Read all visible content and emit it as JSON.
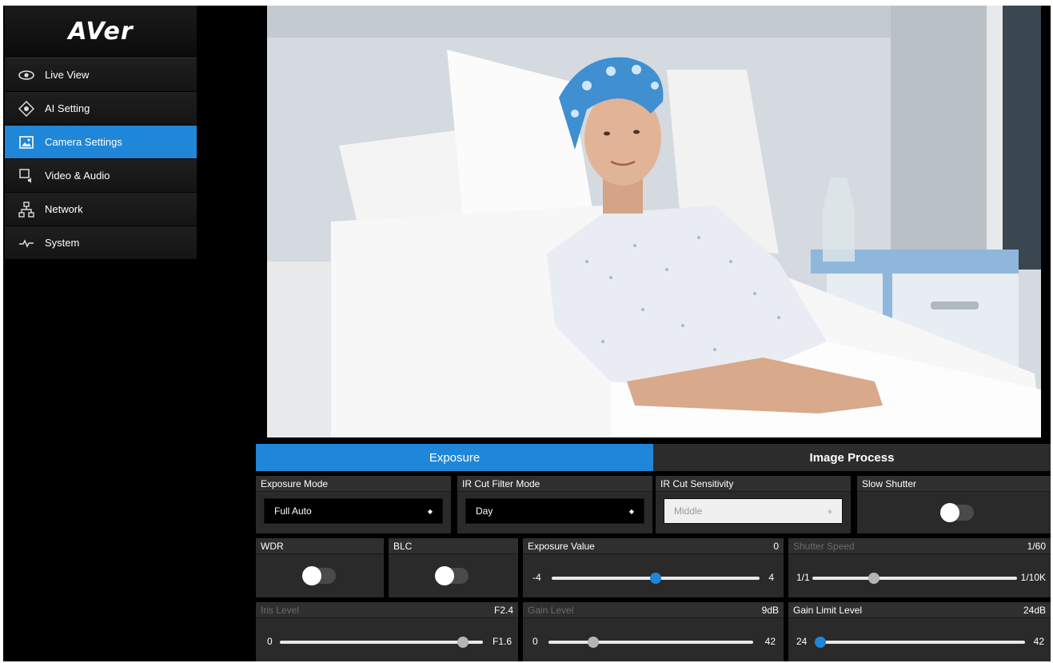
{
  "brand": {
    "logo_text": "AVer"
  },
  "sidebar": {
    "items": [
      {
        "label": "Live View",
        "icon": "eye-icon"
      },
      {
        "label": "AI Setting",
        "icon": "ai-target-icon"
      },
      {
        "label": "Camera Settings",
        "icon": "image-icon",
        "active": true
      },
      {
        "label": "Video & Audio",
        "icon": "video-audio-icon"
      },
      {
        "label": "Network",
        "icon": "network-icon"
      },
      {
        "label": "System",
        "icon": "pulse-icon"
      }
    ]
  },
  "tabs": {
    "exposure": "Exposure",
    "image_process": "Image Process"
  },
  "exposure": {
    "exposure_mode": {
      "label": "Exposure Mode",
      "value": "Full Auto"
    },
    "ir_cut_filter_mode": {
      "label": "IR Cut Filter Mode",
      "value": "Day"
    },
    "ir_cut_sensitivity": {
      "label": "IR Cut Sensitivity",
      "value": "Middle"
    },
    "slow_shutter": {
      "label": "Slow Shutter",
      "on": false
    },
    "wdr": {
      "label": "WDR",
      "on": false
    },
    "blc": {
      "label": "BLC",
      "on": false
    },
    "exposure_value": {
      "label": "Exposure Value",
      "value": "0",
      "min": "-4",
      "max": "4",
      "position": 0.5
    },
    "shutter_speed": {
      "label": "Shutter Speed",
      "value": "1/60",
      "min": "1/1",
      "max": "1/10K",
      "position": 0.3
    },
    "iris_level": {
      "label": "Iris Level",
      "value": "F2.4",
      "min": "0",
      "max": "F1.6",
      "position": 0.9
    },
    "gain_level": {
      "label": "Gain Level",
      "value": "9dB",
      "min": "0",
      "max": "42",
      "position": 0.22
    },
    "gain_limit_level": {
      "label": "Gain Limit Level",
      "value": "24dB",
      "min": "24",
      "max": "42",
      "position": 0.0
    }
  },
  "colors": {
    "accent": "#1f86d8",
    "panel": "#2a2a2a",
    "background": "#000000"
  }
}
